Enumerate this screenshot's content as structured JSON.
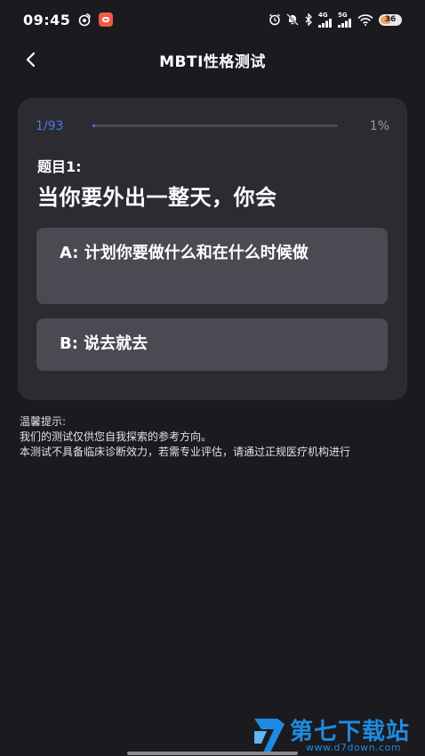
{
  "status_bar": {
    "time": "09:45",
    "signal_1_label": "4G",
    "signal_2_label": "5G",
    "battery": "36",
    "icons": [
      "weibo-icon",
      "app-icon",
      "alarm-icon",
      "mute-icon",
      "bluetooth-icon",
      "signal-icon",
      "wifi-icon",
      "battery-icon"
    ]
  },
  "header": {
    "title": "MBTI性格测试",
    "back_icon": "chevron-left-icon"
  },
  "progress": {
    "count": "1/93",
    "percent": "1%",
    "fraction": 0.01,
    "accent_color": "#4a78e8"
  },
  "question": {
    "label": "题目1:",
    "text": "当你要外出一整天，你会"
  },
  "options": [
    {
      "label": "A:  计划你要做什么和在什么时候做"
    },
    {
      "label": "B:  说去就去"
    }
  ],
  "tips": {
    "title": "温馨提示:",
    "line1": "我们的测试仅供您自我探索的参考方向。",
    "line2": "本测试不具备临床诊断效力，若需专业评估，请通过正规医疗机构进行"
  },
  "watermark": {
    "name": "第七下载站",
    "url": "www.d7down.com"
  }
}
